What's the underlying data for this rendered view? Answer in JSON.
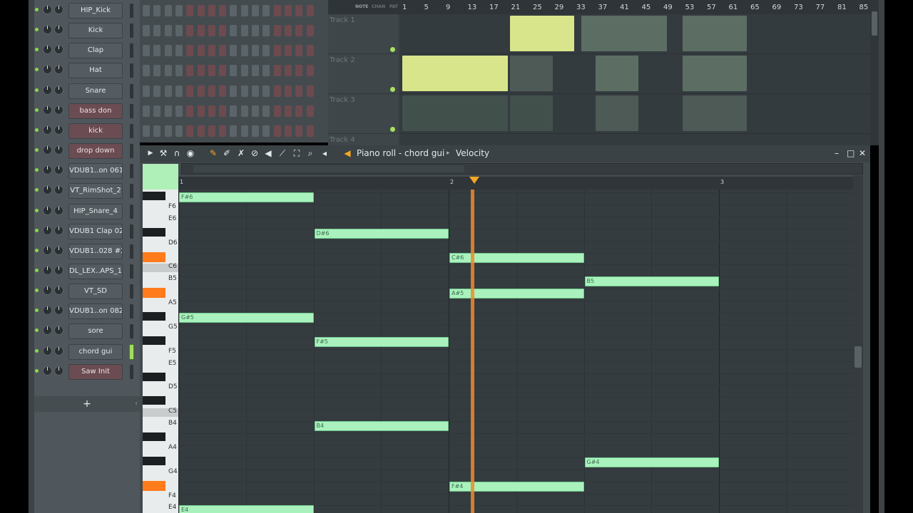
{
  "channels": [
    {
      "name": "HIP_Kick",
      "style": "dark"
    },
    {
      "name": "Kick",
      "style": "dark"
    },
    {
      "name": "Clap",
      "style": "dark"
    },
    {
      "name": "Hat",
      "style": "dark"
    },
    {
      "name": "Snare",
      "style": "dark"
    },
    {
      "name": "bass don",
      "style": "red"
    },
    {
      "name": "kick",
      "style": "red"
    },
    {
      "name": "drop down",
      "style": "red"
    },
    {
      "name": "VDUB1..on 061",
      "style": "dark"
    },
    {
      "name": "VT_RimShot_2",
      "style": "dark"
    },
    {
      "name": "HIP_Snare_4",
      "style": "dark"
    },
    {
      "name": "VDUB1 Clap 028",
      "style": "dark"
    },
    {
      "name": "VDUB1..028 #2",
      "style": "dark"
    },
    {
      "name": "DL_LEX..APS_11",
      "style": "dark"
    },
    {
      "name": "VT_SD",
      "style": "dark"
    },
    {
      "name": "VDUB1..on 082",
      "style": "dark"
    },
    {
      "name": "sore",
      "style": "dark"
    },
    {
      "name": "chord gui",
      "style": "dark",
      "selected": true
    },
    {
      "name": "Saw Init",
      "style": "red"
    }
  ],
  "channel_rack": {
    "add_label": "+",
    "collapse": "‹"
  },
  "playlist": {
    "tabs": [
      "NOTE",
      "CHAN",
      "PAT"
    ],
    "ruler": [
      "1",
      "5",
      "9",
      "13",
      "17",
      "21",
      "25",
      "29",
      "33",
      "37",
      "41",
      "45",
      "49",
      "53",
      "57",
      "61",
      "65",
      "69",
      "73",
      "77",
      "81",
      "85"
    ],
    "tracks": [
      "Track 1",
      "Track 2",
      "Track 3",
      "Track 4"
    ]
  },
  "piano_roll": {
    "title": "Piano roll - chord gui",
    "separator": "▸",
    "target": "Velocity",
    "ruler": [
      "1",
      "2",
      "3"
    ],
    "key_labels": [
      "F6",
      "E6",
      "D6",
      "C6",
      "B5",
      "A5",
      "G5",
      "F5",
      "E5",
      "D5",
      "C5",
      "B4",
      "A4",
      "G4",
      "F4",
      "E4"
    ],
    "notes": [
      {
        "label": "F#6",
        "key": "F#6",
        "start": 0,
        "len": 1
      },
      {
        "label": "D#6",
        "key": "D#6",
        "start": 1,
        "len": 1
      },
      {
        "label": "C#6",
        "key": "C#6",
        "start": 2,
        "len": 1
      },
      {
        "label": "B5",
        "key": "B5",
        "start": 3,
        "len": 1
      },
      {
        "label": "A#5",
        "key": "A#5",
        "start": 2,
        "len": 1
      },
      {
        "label": "G#5",
        "key": "G#5",
        "start": 0,
        "len": 1
      },
      {
        "label": "F#5",
        "key": "F#5",
        "start": 1,
        "len": 1
      },
      {
        "label": "B4",
        "key": "B4",
        "start": 1,
        "len": 1
      },
      {
        "label": "G#4",
        "key": "G#4",
        "start": 3,
        "len": 1
      },
      {
        "label": "F#4",
        "key": "F#4",
        "start": 2,
        "len": 1
      },
      {
        "label": "E4",
        "key": "E4",
        "start": 0,
        "len": 1
      }
    ],
    "window_buttons": {
      "minimize": "–",
      "maximize": "□",
      "close": "✕"
    }
  }
}
